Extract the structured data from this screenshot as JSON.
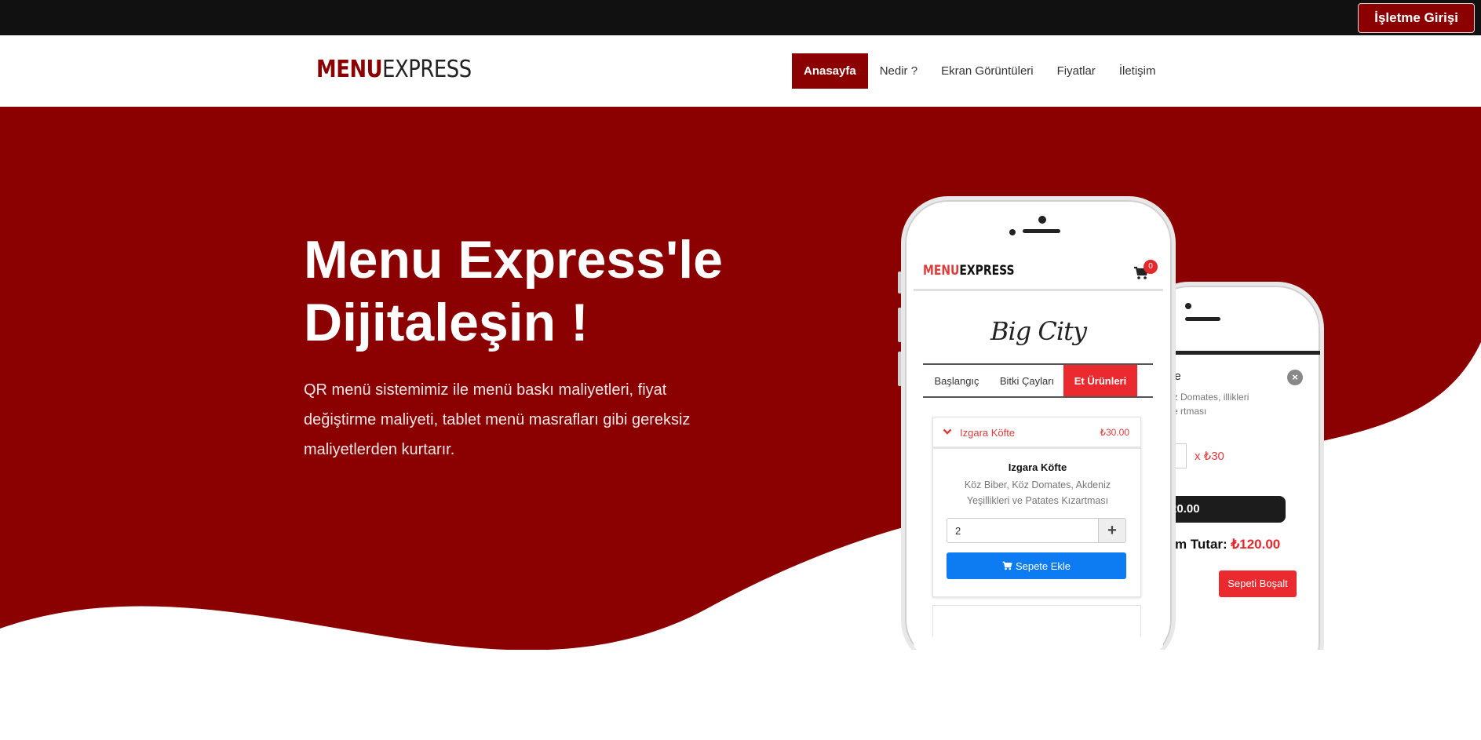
{
  "topbar": {
    "biz_login_label": "İşletme Girişi"
  },
  "navbar": {
    "logo_part1": "MENU",
    "logo_part2": "EXPRESS",
    "items": [
      {
        "label": "Anasayfa",
        "active": true
      },
      {
        "label": "Nedir ?"
      },
      {
        "label": "Ekran Görüntüleri"
      },
      {
        "label": "Fiyatlar"
      },
      {
        "label": "İletişim"
      }
    ]
  },
  "hero": {
    "title_line1": "Menu Express'le",
    "title_line2": "Dijitaleşin !",
    "text": "QR menü sistemimiz ile menü baskı maliyetleri, fiyat değiştirme maliyeti, tablet menü masrafları gibi gereksiz maliyetlerden kurtarır."
  },
  "phone_main": {
    "app_logo_part1": "MENU",
    "app_logo_part2": "EXPRESS",
    "cart_count": "0",
    "brand": "Big City",
    "tabs": [
      "Başlangıç",
      "Bitki Çayları",
      "Et Ürünleri"
    ],
    "active_tab": "Et Ürünleri",
    "item": {
      "name": "Izgara Köfte",
      "price": "₺30.00",
      "title": "Izgara Köfte",
      "description": "Köz Biber, Köz Domates, Akdeniz Yeşillikleri ve Patates Kızartması",
      "quantity": "2",
      "plus": "+",
      "add_label": "Sepete Ekle"
    }
  },
  "phone_cart": {
    "item_name": "fte",
    "description": "öz Domates, illikleri ve rtması",
    "unit_price": "x ₺30",
    "subtotal": ": ₺120.00",
    "total_label": "oplam Tutar:",
    "total_value": "₺120.00",
    "close": "×",
    "empty_label": "Sepeti Boşalt"
  },
  "colors": {
    "brand_dark_red": "#8b0000",
    "accent_red": "#ea2a2f",
    "button_blue": "#0d7cf2",
    "topbar": "#111111"
  }
}
